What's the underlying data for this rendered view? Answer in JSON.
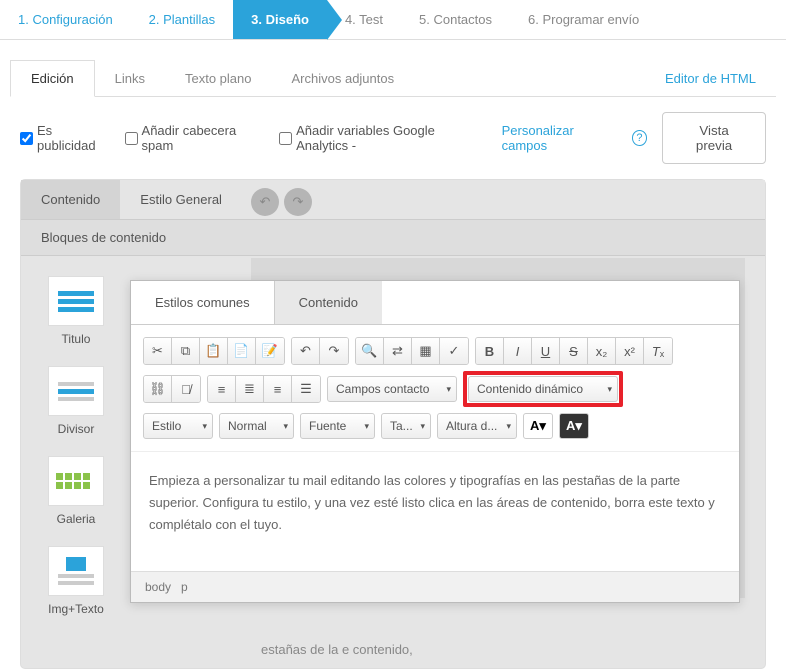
{
  "wizard": {
    "steps": [
      {
        "label": "1. Configuración",
        "state": "done"
      },
      {
        "label": "2. Plantillas",
        "state": "done"
      },
      {
        "label": "3. Diseño",
        "state": "active"
      },
      {
        "label": "4. Test",
        "state": ""
      },
      {
        "label": "5. Contactos",
        "state": ""
      },
      {
        "label": "6. Programar envío",
        "state": ""
      }
    ]
  },
  "editTabs": {
    "edicion": "Edición",
    "links": "Links",
    "textoPlano": "Texto plano",
    "archivos": "Archivos adjuntos",
    "editorHtml": "Editor de HTML"
  },
  "options": {
    "esPublicidad": "Es publicidad",
    "cabeceraSpam": "Añadir cabecera spam",
    "variablesGA": "Añadir variables Google Analytics -",
    "personalizar": "Personalizar campos",
    "vistaPrevia": "Vista previa"
  },
  "innerTabs": {
    "contenido": "Contenido",
    "estiloGeneral": "Estilo General",
    "bloquesHeader": "Bloques de contenido"
  },
  "blocks": {
    "titulo": "Titulo",
    "divisor": "Divisor",
    "galeria": "Galeria",
    "imgTexto": "Img+Texto"
  },
  "bgText": "estañas de la\ne contenido,",
  "modal": {
    "tabs": {
      "estilos": "Estilos comunes",
      "contenido": "Contenido"
    },
    "toolbar": {
      "camposContacto": "Campos contacto",
      "contenidoDinamico": "Contenido dinámico",
      "estilo": "Estilo",
      "normal": "Normal",
      "fuente": "Fuente",
      "ta": "Ta...",
      "altura": "Altura d..."
    },
    "text": "Empieza a personalizar tu mail editando las colores y tipografías en las pestañas de la parte superior. Configura tu estilo, y una vez esté listo clica en las áreas de contenido, borra este texto y complétalo con el tuyo.",
    "breadcrumb": {
      "body": "body",
      "p": "p"
    }
  }
}
